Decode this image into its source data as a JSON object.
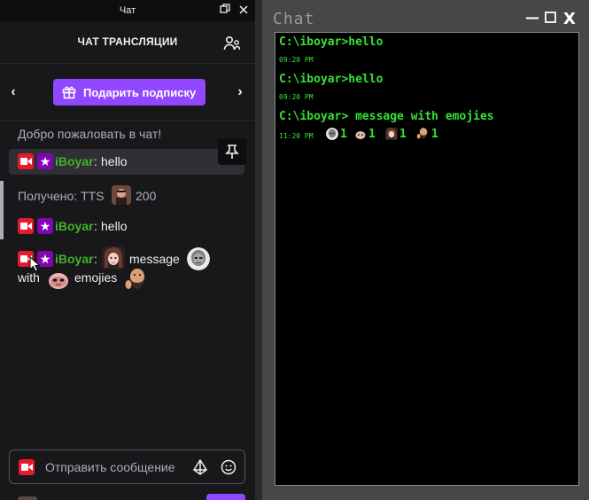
{
  "twitch": {
    "window_title": "Чат",
    "header_title": "ЧАТ ТРАНСЛЯЦИИ",
    "gift_button": "Подарить подписку",
    "welcome": "Добро пожаловать в чат!",
    "messages": [
      {
        "user": "iBoyar",
        "sep": ":",
        "text": "hello",
        "highlighted": true
      },
      {
        "kind": "tts",
        "prefix": "Получено: TTS",
        "amount": "200"
      },
      {
        "user": "iBoyar",
        "sep": ":",
        "text": "hello"
      },
      {
        "user": "iBoyar",
        "sep": ":",
        "word1": "message",
        "word2": "with",
        "word3": "emojies",
        "emotes": [
          "anime-girl-emote",
          "bald-man-emote",
          "pink-creature-emote",
          "bearded-man-emote"
        ]
      }
    ],
    "input_placeholder": "Отправить сообщение",
    "colors": {
      "accent": "#9147ff",
      "username": "#43b02a",
      "bg": "#18181b"
    }
  },
  "terminal": {
    "title": "Chat",
    "controls": {
      "minimize": "—",
      "maximize": "☐",
      "close": "X"
    },
    "entries": [
      {
        "cmd": "C:\\iboyar>hello",
        "time": "09:20 PM"
      },
      {
        "cmd": "C:\\iboyar>hello",
        "time": "09:20 PM"
      },
      {
        "cmd": "C:\\iboyar> message with emojies",
        "time": "11:20 PM",
        "emote_counts": [
          {
            "emote": "bald-man-emote",
            "count": "1"
          },
          {
            "emote": "pink-creature-emote",
            "count": "1"
          },
          {
            "emote": "anime-girl-emote",
            "count": "1"
          },
          {
            "emote": "bearded-man-emote",
            "count": "1"
          }
        ]
      }
    ],
    "colors": {
      "text": "#36e236",
      "bg": "#000000",
      "frame": "#474747"
    }
  }
}
